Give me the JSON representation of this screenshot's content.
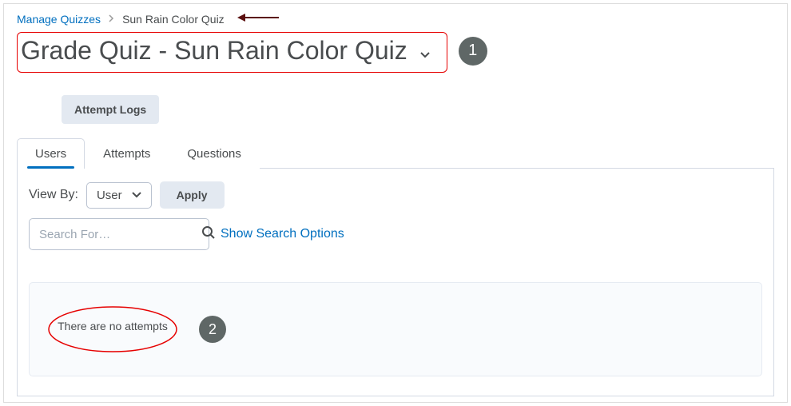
{
  "breadcrumb": {
    "root_label": "Manage Quizzes",
    "current_label": "Sun Rain Color Quiz"
  },
  "title": "Grade Quiz - Sun Rain Color Quiz",
  "callouts": {
    "badge1": "1",
    "badge2": "2"
  },
  "buttons": {
    "attempt_logs": "Attempt Logs",
    "apply": "Apply"
  },
  "tabs": {
    "users": "Users",
    "attempts": "Attempts",
    "questions": "Questions"
  },
  "viewby": {
    "label": "View By:",
    "selected": "User"
  },
  "search": {
    "placeholder": "Search For…",
    "show_options": "Show Search Options"
  },
  "results": {
    "empty_message": "There are no attempts"
  },
  "colors": {
    "link": "#006fbf",
    "callout_red": "#e60000",
    "badge_bg": "#5f6766"
  }
}
